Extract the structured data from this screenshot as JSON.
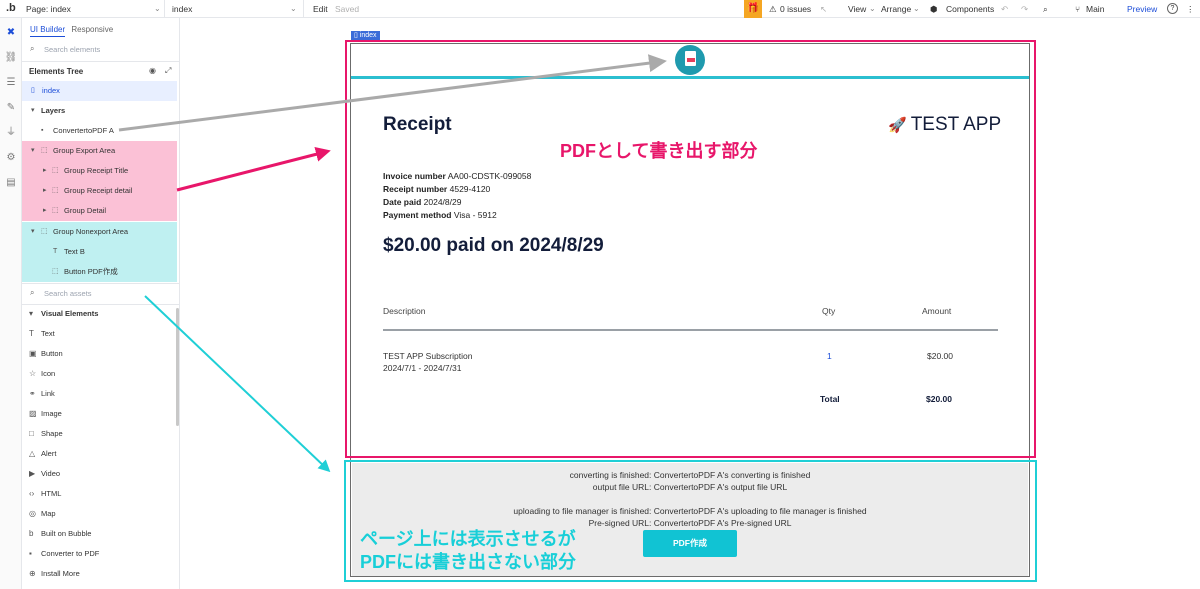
{
  "topbar": {
    "logo": ".b",
    "page_label": "Page: index",
    "page2": "index",
    "edit": "Edit",
    "saved": "Saved",
    "issues": "0 issues",
    "view": "View",
    "arrange": "Arrange",
    "components": "Components",
    "branch": "Main",
    "preview": "Preview",
    "help": "?"
  },
  "panel": {
    "tab_builder": "UI Builder",
    "tab_responsive": "Responsive",
    "search_elements": "Search elements",
    "elements_tree": "Elements Tree",
    "index": "index",
    "layers": "Layers",
    "tree": [
      {
        "label": "ConvertertoPDF A"
      },
      {
        "label": "Group Export Area"
      },
      {
        "label": "Group Receipt Title"
      },
      {
        "label": "Group Receipt detail"
      },
      {
        "label": "Group Detail"
      },
      {
        "label": "Group Nonexport Area"
      },
      {
        "label": "Text B"
      },
      {
        "label": "Button PDF作成"
      }
    ],
    "search_assets": "Search assets",
    "visual_elements": "Visual Elements",
    "visual_items": [
      "Text",
      "Button",
      "Icon",
      "Link",
      "Image",
      "Shape",
      "Alert",
      "Video",
      "HTML",
      "Map",
      "Built on Bubble",
      "Converter to PDF",
      "Install More"
    ]
  },
  "canvas": {
    "index_tag": "index",
    "receipt_title": "Receipt",
    "app_name": "TEST APP",
    "annotation_export": "PDFとして書き出す部分",
    "invoice_label": "Invoice number",
    "invoice_value": "AA00-CDSTK-099058",
    "receipt_label": "Receipt number",
    "receipt_value": "4529-4120",
    "date_label": "Date paid",
    "date_value": "2024/8/29",
    "method_label": "Payment method",
    "method_value": "Visa - 5912",
    "paid_heading": "$20.00 paid on 2024/8/29",
    "col_description": "Description",
    "col_qty": "Qty",
    "col_amount": "Amount",
    "item_name": "TEST APP Subscription",
    "item_period": "2024/7/1 - 2024/7/31",
    "item_qty": "1",
    "item_amount": "$20.00",
    "total_label": "Total",
    "total_amount": "$20.00",
    "status1": "converting is finished: ConvertertoPDF A's converting is finished",
    "status2": "output file URL: ConvertertoPDF A's output file URL",
    "status3": "uploading to file manager is finished: ConvertertoPDF A's uploading to file manager is finished",
    "status4": "Pre-signed URL: ConvertertoPDF A's Pre-signed URL",
    "pdf_button": "PDF作成",
    "annotation_nonexport_1": "ページ上には表示させるが",
    "annotation_nonexport_2": "PDFには書き出さない部分"
  },
  "colors": {
    "accent_pink": "#e8166a",
    "accent_cyan": "#1fcfd6",
    "arrow_gray": "#aaaaaa",
    "navy": "#131d3a"
  }
}
